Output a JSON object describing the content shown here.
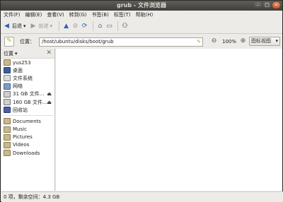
{
  "window": {
    "title": "grub - 文件浏览器"
  },
  "menu": [
    "文件(F)",
    "编辑(E)",
    "查看(V)",
    "转到(G)",
    "书签(B)",
    "标签(T)",
    "帮助(H)"
  ],
  "toolbar": {
    "back": "后退",
    "forward": "前进"
  },
  "location": {
    "label": "位置：",
    "path": "/host/ubuntu/disks/boot/grub",
    "zoom": "100%",
    "view": "图标视图"
  },
  "sidebar": {
    "header": "位置",
    "places": [
      {
        "label": "yus253",
        "icon": "home-folder-icon"
      },
      {
        "label": "桌面",
        "icon": "desktop-icon"
      },
      {
        "label": "文件系统",
        "icon": "filesystem-icon"
      },
      {
        "label": "网络",
        "icon": "network-icon"
      },
      {
        "label": "31 GB 文件…",
        "icon": "drive-icon",
        "eject": true
      },
      {
        "label": "160 GB 文件…",
        "icon": "drive-icon",
        "eject": true
      },
      {
        "label": "回收站",
        "icon": "trash-icon"
      }
    ],
    "bookmarks": [
      {
        "label": "Documents"
      },
      {
        "label": "Music"
      },
      {
        "label": "Pictures"
      },
      {
        "label": "Videos"
      },
      {
        "label": "Downloads"
      }
    ]
  },
  "status": "0 项，剩余空间：4.3 GB",
  "colors": {
    "titlebar": "#3f3e3a",
    "close": "#d9521e",
    "accent": "#2f63b8"
  }
}
